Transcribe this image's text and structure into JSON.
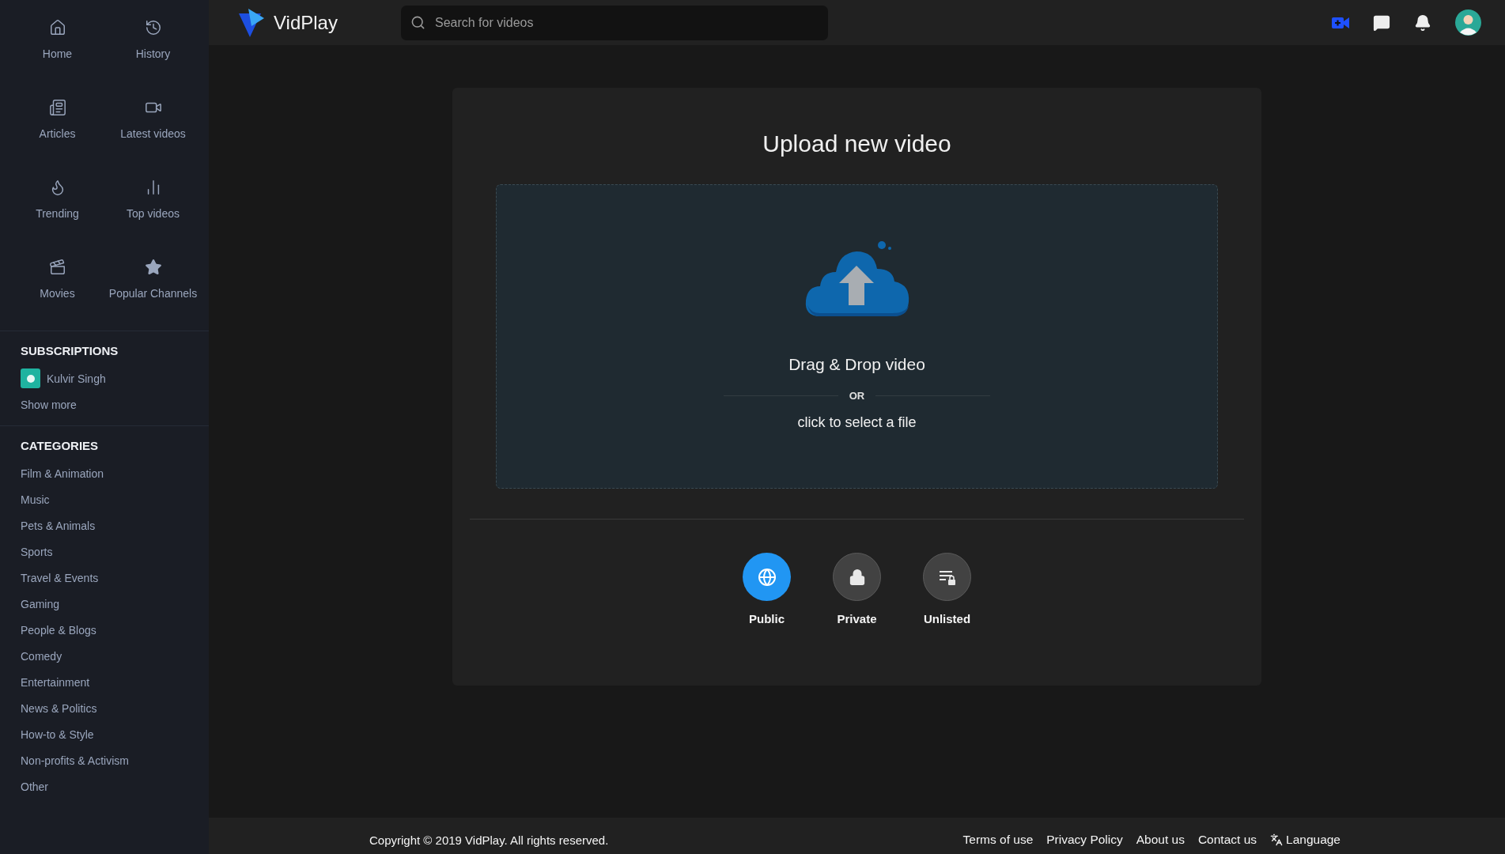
{
  "sidebar": {
    "nav": [
      {
        "kind": "home",
        "label": "Home"
      },
      {
        "kind": "history",
        "label": "History"
      },
      {
        "kind": "articles",
        "label": "Articles"
      },
      {
        "kind": "latest",
        "label": "Latest videos"
      },
      {
        "kind": "trending",
        "label": "Trending"
      },
      {
        "kind": "top",
        "label": "Top videos"
      },
      {
        "kind": "movies",
        "label": "Movies"
      },
      {
        "kind": "channels",
        "label": "Popular Channels"
      }
    ],
    "subscriptions": {
      "heading": "SUBSCRIPTIONS",
      "items": [
        {
          "name": "Kulvir Singh",
          "color": "#1fb3a0"
        }
      ],
      "show_more": "Show more"
    },
    "categories": {
      "heading": "CATEGORIES",
      "items": [
        "Film & Animation",
        "Music",
        "Pets & Animals",
        "Sports",
        "Travel & Events",
        "Gaming",
        "People & Blogs",
        "Comedy",
        "Entertainment",
        "News & Politics",
        "How-to & Style",
        "Non-profits & Activism",
        "Other"
      ]
    }
  },
  "header": {
    "logo": "VidPlay",
    "search": {
      "placeholder": "Search for videos"
    }
  },
  "upload": {
    "title": "Upload new video",
    "drop_text": "Drag & Drop video",
    "separator": "OR",
    "select_text": "click to select a file",
    "visibility": [
      {
        "kind": "public",
        "label": "Public",
        "selected": true
      },
      {
        "kind": "private",
        "label": "Private",
        "selected": false
      },
      {
        "kind": "unlisted",
        "label": "Unlisted",
        "selected": false
      }
    ]
  },
  "footer": {
    "copyright": "Copyright © 2019 VidPlay. All rights reserved.",
    "links": [
      "Terms of use",
      "Privacy Policy",
      "About us",
      "Contact us"
    ],
    "language": "Language"
  }
}
